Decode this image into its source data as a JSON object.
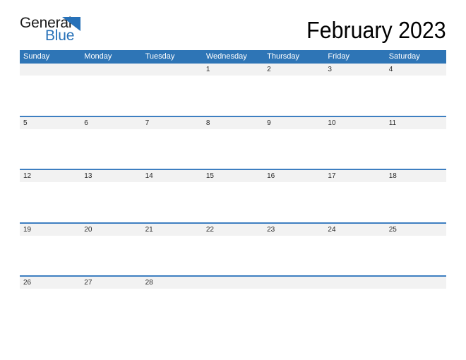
{
  "brand": {
    "name_top": "General",
    "name_bottom": "Blue",
    "triangle_color": "#2771b8",
    "text_color": "#1a1a1a"
  },
  "header": {
    "title": "February 2023",
    "month": "February",
    "year": "2023"
  },
  "colors": {
    "header_blue": "#2e75b6",
    "rule_blue": "#3e7fc1",
    "date_band_gray": "#f2f2f2",
    "day_text": "#2b2b2b",
    "dow_text": "#ffffff",
    "page_background": "#ffffff"
  },
  "calendar": {
    "day_headers": [
      "Sunday",
      "Monday",
      "Tuesday",
      "Wednesday",
      "Thursday",
      "Friday",
      "Saturday"
    ],
    "weeks": [
      [
        "",
        "",
        "",
        "1",
        "2",
        "3",
        "4"
      ],
      [
        "5",
        "6",
        "7",
        "8",
        "9",
        "10",
        "11"
      ],
      [
        "12",
        "13",
        "14",
        "15",
        "16",
        "17",
        "18"
      ],
      [
        "19",
        "20",
        "21",
        "22",
        "23",
        "24",
        "25"
      ],
      [
        "26",
        "27",
        "28",
        "",
        "",
        "",
        ""
      ]
    ]
  }
}
